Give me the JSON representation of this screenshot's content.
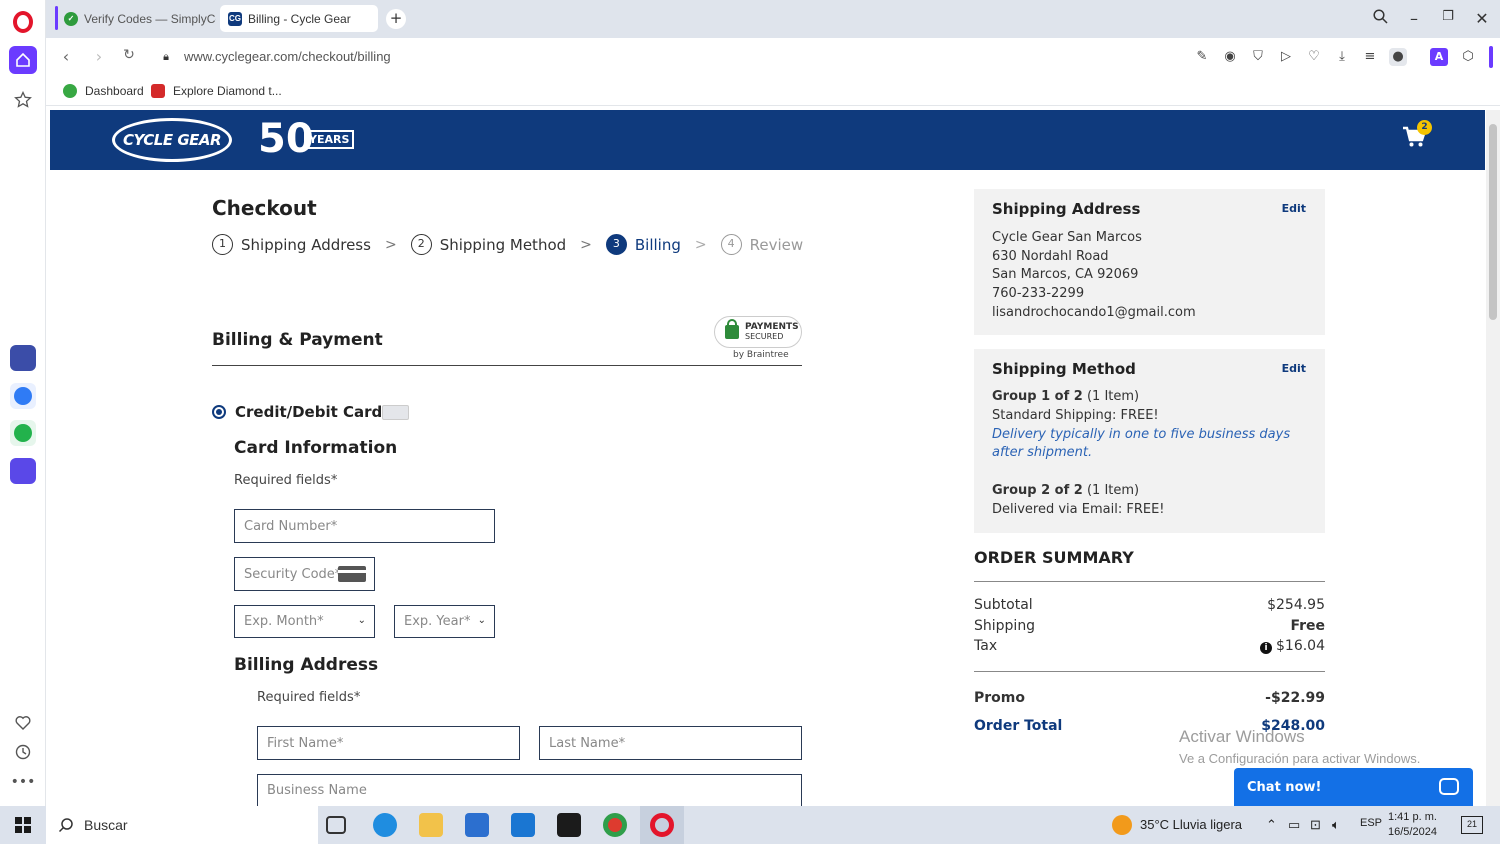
{
  "browser": {
    "tabs": [
      {
        "title": "Verify Codes — SimplyCo",
        "active": false
      },
      {
        "title": "Billing - Cycle Gear",
        "active": true,
        "favicon": "CG"
      }
    ],
    "url": "www.cyclegear.com/checkout/billing",
    "bookmarks": [
      {
        "label": "Dashboard"
      },
      {
        "label": "Explore Diamond t..."
      }
    ]
  },
  "header": {
    "logo_text": "CYCLE GEAR",
    "anniversary_number": "50",
    "anniversary_word": "YEARS",
    "cart_count": "2"
  },
  "checkout": {
    "title": "Checkout",
    "steps": [
      {
        "num": "1",
        "label": "Shipping Address"
      },
      {
        "num": "2",
        "label": "Shipping Method"
      },
      {
        "num": "3",
        "label": "Billing"
      },
      {
        "num": "4",
        "label": "Review"
      }
    ],
    "billing_title": "Billing & Payment",
    "secured": {
      "line1": "PAYMENTS",
      "line2": "SECURED",
      "by": "by Braintree"
    },
    "payment_option": "Credit/Debit Card",
    "card_info_title": "Card Information",
    "required_note": "Required fields*",
    "card_number_placeholder": "Card Number*",
    "security_code_placeholder": "Security Code*",
    "exp_month_placeholder": "Exp. Month*",
    "exp_year_placeholder": "Exp. Year*",
    "billing_address_title": "Billing Address",
    "billing_required_note": "Required fields*",
    "first_name_placeholder": "First Name*",
    "last_name_placeholder": "Last Name*",
    "business_name_placeholder": "Business Name"
  },
  "sidebar": {
    "shipping_address": {
      "title": "Shipping Address",
      "edit": "Edit",
      "lines": [
        "Cycle Gear San Marcos",
        "630 Nordahl Road",
        "San Marcos, CA 92069",
        "760-233-2299",
        "lisandrochocando1@gmail.com"
      ]
    },
    "shipping_method": {
      "title": "Shipping Method",
      "edit": "Edit",
      "group1_label": "Group 1 of 2",
      "group1_count": "(1 Item)",
      "group1_method": "Standard Shipping: FREE!",
      "group1_note1": "Delivery typically in one to five business days",
      "group1_note2": "after shipment.",
      "group2_label": "Group 2 of 2",
      "group2_count": "(1 Item)",
      "group2_method": "Delivered via Email: FREE!"
    },
    "order_summary": {
      "title": "ORDER SUMMARY",
      "subtotal_label": "Subtotal",
      "subtotal_value": "$254.95",
      "shipping_label": "Shipping",
      "shipping_value": "Free",
      "tax_label": "Tax",
      "tax_value": "$16.04",
      "promo_label": "Promo",
      "promo_value": "-$22.99",
      "total_label": "Order Total",
      "total_value": "$248.00"
    }
  },
  "watermark": {
    "line1": "Activar Windows",
    "line2": "Ve a Configuración para activar Windows."
  },
  "chat": {
    "label": "Chat now!"
  },
  "taskbar": {
    "search_placeholder": "Buscar",
    "weather": "35°C  Lluvia ligera",
    "language": "ESP",
    "time": "1:41 p. m.",
    "date": "16/5/2024",
    "notifications": "21"
  },
  "colors": {
    "brand_blue": "#0f3a7d",
    "chat_blue": "#1370e6",
    "opera_red": "#e3152b",
    "opera_purple": "#6b3bff"
  }
}
